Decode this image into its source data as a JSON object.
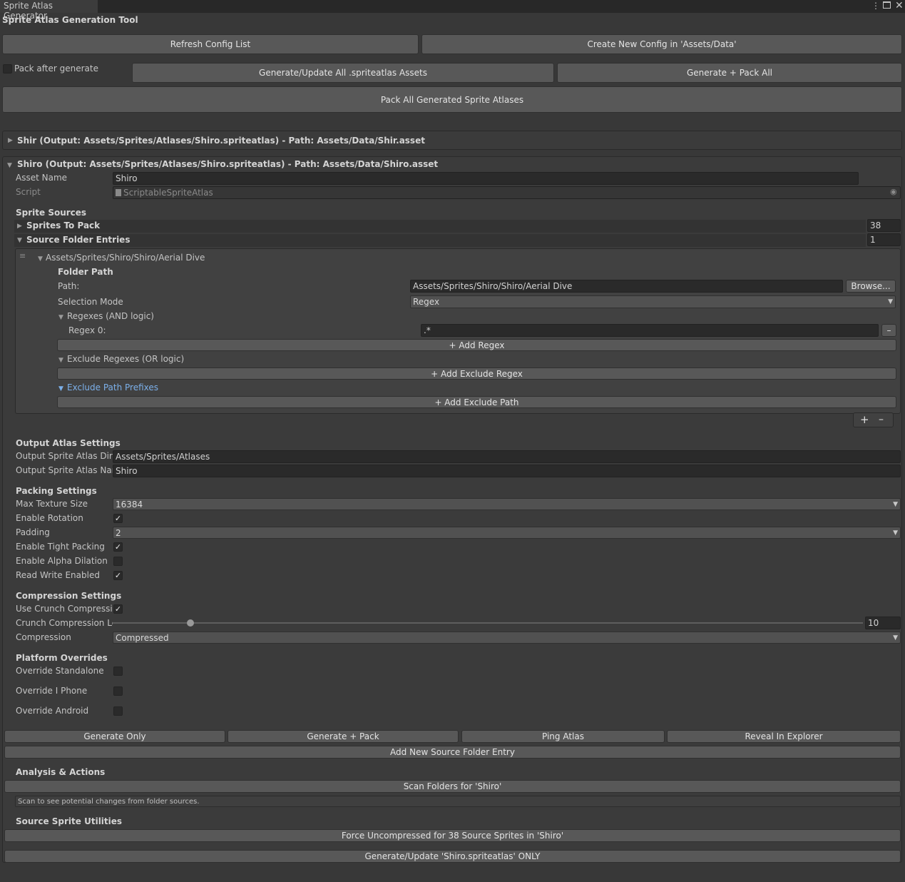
{
  "window": {
    "tab_title": "Sprite Atlas Generator",
    "menu_icon": "kebab-menu-icon",
    "maximize_icon": "maximize-icon",
    "close_icon": "close-icon"
  },
  "header": {
    "title": "Sprite Atlas Generation Tool"
  },
  "toolbar": {
    "refresh": "Refresh Config List",
    "create_new": "Create New Config in 'Assets/Data'",
    "pack_after_generate": "Pack after generate",
    "pack_after_generate_checked": false,
    "generate_all": "Generate/Update All .spriteatlas Assets",
    "generate_pack_all": "Generate + Pack All",
    "pack_all": "Pack All Generated Sprite Atlases"
  },
  "configs": [
    {
      "header": "Shir (Output: Assets/Sprites/Atlases/Shiro.spriteatlas) - Path: Assets/Data/Shir.asset",
      "expanded": false
    },
    {
      "header": "Shiro (Output: Assets/Sprites/Atlases/Shiro.spriteatlas) - Path: Assets/Data/Shiro.asset",
      "expanded": true
    }
  ],
  "shiro": {
    "asset_name_label": "Asset Name",
    "asset_name": "Shiro",
    "script_label": "Script",
    "script_value": "ScriptableSpriteAtlas",
    "sprite_sources": {
      "heading": "Sprite Sources",
      "sprites_to_pack_label": "Sprites To Pack",
      "sprites_to_pack_count": "38",
      "source_folder_entries_label": "Source Folder Entries",
      "source_folder_entries_count": "1",
      "entry": {
        "title": "Assets/Sprites/Shiro/Shiro/Aerial Dive",
        "folder_path_heading": "Folder Path",
        "path_label": "Path:",
        "path_value": "Assets/Sprites/Shiro/Shiro/Aerial Dive",
        "browse": "Browse...",
        "selection_mode_label": "Selection Mode",
        "selection_mode": "Regex",
        "regexes_heading": "Regexes (AND logic)",
        "regex0_label": "Regex 0:",
        "regex0_value": ".*",
        "remove_symbol": "–",
        "add_regex": "+ Add Regex",
        "exclude_regexes_heading": "Exclude Regexes (OR logic)",
        "add_exclude_regex": "+ Add Exclude Regex",
        "exclude_path_prefixes_heading": "Exclude Path Prefixes",
        "add_exclude_path": "+ Add Exclude Path"
      },
      "list_add": "+",
      "list_remove": "–"
    },
    "output": {
      "heading": "Output Atlas Settings",
      "dir_label": "Output Sprite Atlas Direc",
      "dir_value": "Assets/Sprites/Atlases",
      "name_label": "Output Sprite Atlas Nam",
      "name_value": "Shiro"
    },
    "packing": {
      "heading": "Packing Settings",
      "max_texture_size_label": "Max Texture Size",
      "max_texture_size": "16384",
      "enable_rotation_label": "Enable Rotation",
      "enable_rotation": true,
      "padding_label": "Padding",
      "padding": "2",
      "tight_packing_label": "Enable Tight Packing",
      "tight_packing": true,
      "alpha_dilation_label": "Enable Alpha Dilation",
      "alpha_dilation": false,
      "read_write_label": "Read Write Enabled",
      "read_write": true
    },
    "compression": {
      "heading": "Compression Settings",
      "use_crunch_label": "Use Crunch Compressio",
      "use_crunch": true,
      "crunch_level_label": "Crunch Compression Le",
      "crunch_level": "10",
      "crunch_level_fraction": 0.1,
      "compression_label": "Compression",
      "compression": "Compressed"
    },
    "platform": {
      "heading": "Platform Overrides",
      "standalone_label": "Override Standalone",
      "standalone": false,
      "iphone_label": "Override I Phone",
      "iphone": false,
      "android_label": "Override Android",
      "android": false
    },
    "actions": {
      "generate_only": "Generate Only",
      "generate_pack": "Generate + Pack",
      "ping_atlas": "Ping Atlas",
      "reveal": "Reveal In Explorer",
      "add_source_folder": "Add New Source Folder Entry"
    },
    "analysis": {
      "heading": "Analysis & Actions",
      "scan": "Scan Folders for 'Shiro'",
      "scan_hint": "Scan to see potential changes from folder sources."
    },
    "utilities": {
      "heading": "Source Sprite Utilities",
      "force_uncompressed": "Force Uncompressed for 38 Source Sprites in 'Shiro'",
      "generate_only_atlas": "Generate/Update 'Shiro.spriteatlas' ONLY"
    }
  },
  "icons": {
    "check": "✓",
    "fold_closed": "▶",
    "fold_open": "▼",
    "dropdown": "▼",
    "object_picker": "◉",
    "drag_handle": "≡"
  }
}
